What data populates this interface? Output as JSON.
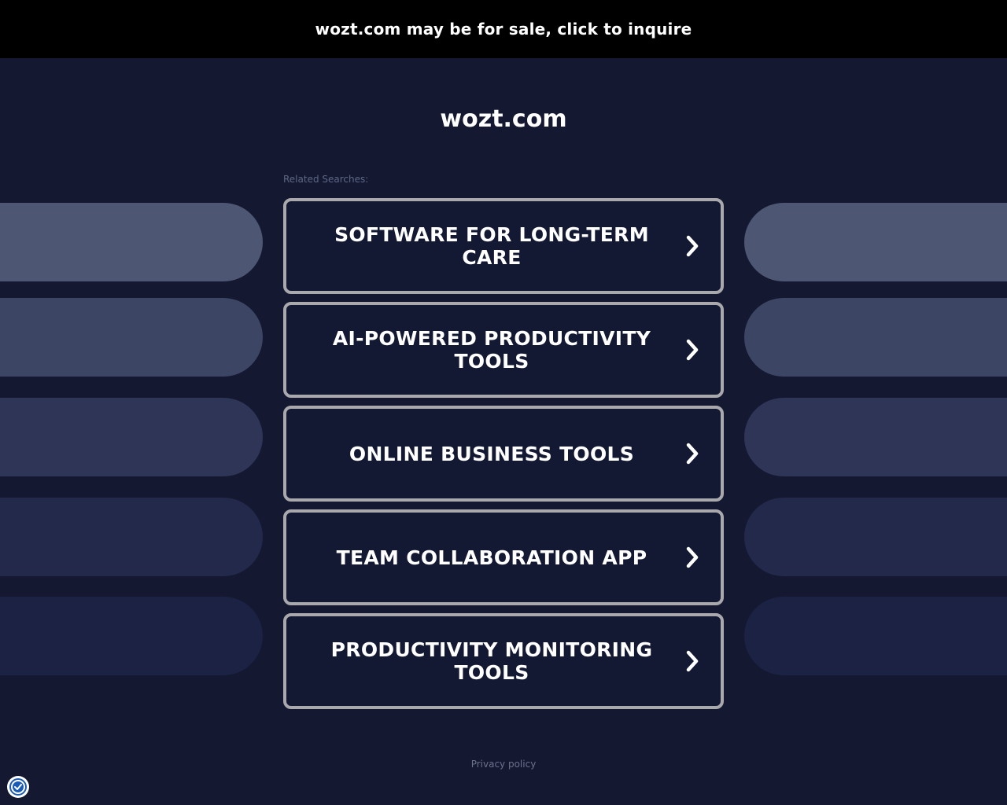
{
  "banner": {
    "text": "wozt.com may be for sale, click to inquire"
  },
  "domain": {
    "title": "wozt.com"
  },
  "related": {
    "label": "Related Searches:",
    "items": [
      {
        "label": "SOFTWARE FOR LONG-TERM CARE"
      },
      {
        "label": "AI-POWERED PRODUCTIVITY TOOLS"
      },
      {
        "label": "ONLINE BUSINESS TOOLS"
      },
      {
        "label": "TEAM COLLABORATION APP"
      },
      {
        "label": "PRODUCTIVITY MONITORING TOOLS"
      }
    ]
  },
  "decor": {
    "pill_colors": [
      "#4d5673",
      "#3d4565",
      "#2e3556",
      "#22294b",
      "#1b2244"
    ]
  },
  "footer": {
    "privacy_label": "Privacy policy"
  },
  "colors": {
    "background": "#141830",
    "banner": "#000000",
    "box_border": "#a8a8ad",
    "text": "#ffffff"
  },
  "icons": {
    "chevron": "chevron-right-icon",
    "badge": "shield-check-icon"
  }
}
